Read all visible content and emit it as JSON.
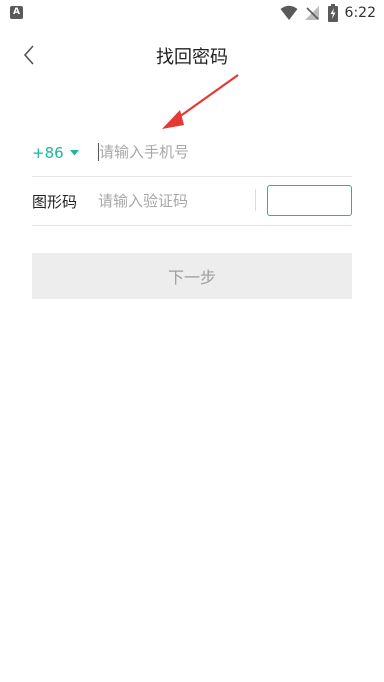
{
  "status_bar": {
    "app_icon": "A",
    "time": "6:22",
    "icons": [
      "wifi-icon",
      "signal-off-icon",
      "battery-charging-icon"
    ]
  },
  "nav": {
    "title": "找回密码",
    "back_icon": "chevron-left-icon"
  },
  "phone": {
    "country_code": "+86",
    "caret_icon": "caret-down-icon",
    "placeholder": "请输入手机号"
  },
  "captcha": {
    "label": "图形码",
    "placeholder": "请输入验证码"
  },
  "next_button": {
    "label": "下一步"
  },
  "colors": {
    "accent": "#20b59d",
    "annotation_arrow": "#e53935",
    "button_bg": "#ededed",
    "button_text": "#9e9e9e",
    "placeholder": "#a8a8a8"
  }
}
